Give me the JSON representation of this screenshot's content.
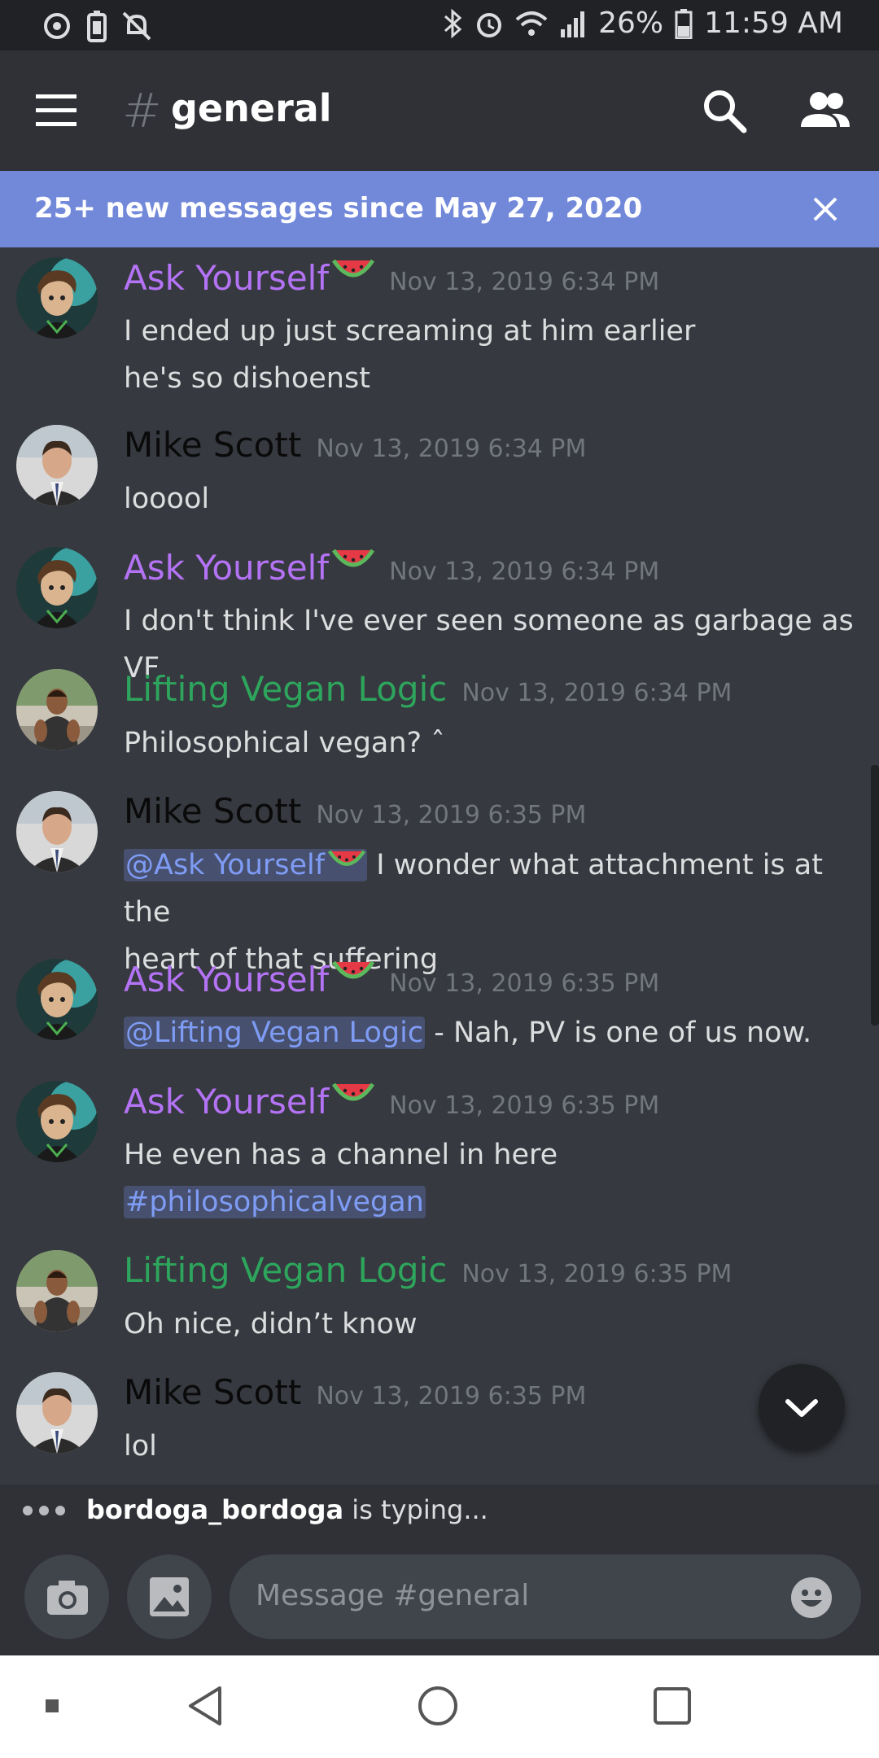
{
  "status_bar": {
    "battery": "26%",
    "time": "11:59 AM"
  },
  "header": {
    "hash": "#",
    "channel": "general"
  },
  "banner": {
    "text": "25+ new messages since May 27, 2020"
  },
  "messages": [
    {
      "author": "Ask Yourself",
      "author_color": "#b473f5",
      "emoji": "watermelon",
      "time": "Nov 13, 2019 6:34 PM",
      "lines": [
        "I ended up just screaming at him earlier",
        "he's so dishoenst"
      ]
    },
    {
      "author": "Mike Scott",
      "author_color": "#0a0a0a",
      "time": "Nov 13, 2019 6:34 PM",
      "lines": [
        "looool"
      ]
    },
    {
      "author": "Ask Yourself",
      "author_color": "#b473f5",
      "emoji": "watermelon",
      "time": "Nov 13, 2019 6:34 PM",
      "lines": [
        "I don't think I've ever seen someone as garbage as VF"
      ]
    },
    {
      "author": "Lifting Vegan Logic",
      "author_color": "#2ea55c",
      "time": "Nov 13, 2019 6:34 PM",
      "lines": [
        "Philosophical vegan? ˆ"
      ]
    },
    {
      "author": "Mike Scott",
      "author_color": "#0a0a0a",
      "time": "Nov 13, 2019 6:35 PM",
      "mention": "@Ask Yourself",
      "line1_rest": " I wonder what attachment is at the",
      "line2": "heart of that suffering"
    },
    {
      "author": "Ask Yourself",
      "author_color": "#b473f5",
      "emoji": "watermelon",
      "time": "Nov 13, 2019 6:35 PM",
      "mention": "@Lifting Vegan Logic",
      "line1_rest": " - Nah, PV is one of us now."
    },
    {
      "author": "Ask Yourself",
      "author_color": "#b473f5",
      "emoji": "watermelon",
      "time": "Nov 13, 2019 6:35 PM",
      "line1": "He even has a channel in here",
      "channel_link": "#philosophicalvegan"
    },
    {
      "author": "Lifting Vegan Logic",
      "author_color": "#2ea55c",
      "time": "Nov 13, 2019 6:35 PM",
      "lines": [
        "Oh nice, didn’t know"
      ]
    },
    {
      "author": "Mike Scott",
      "author_color": "#0a0a0a",
      "time": "Nov 13, 2019 6:35 PM",
      "lines": [
        "lol"
      ]
    }
  ],
  "typing": {
    "user": "bordoga_bordoga",
    "text": " is typing..."
  },
  "composer": {
    "placeholder": "Message #general"
  },
  "colors": {
    "background": "#36393f",
    "header": "#2f3136",
    "banner": "#7289da",
    "mention": "#7f9cf5"
  }
}
